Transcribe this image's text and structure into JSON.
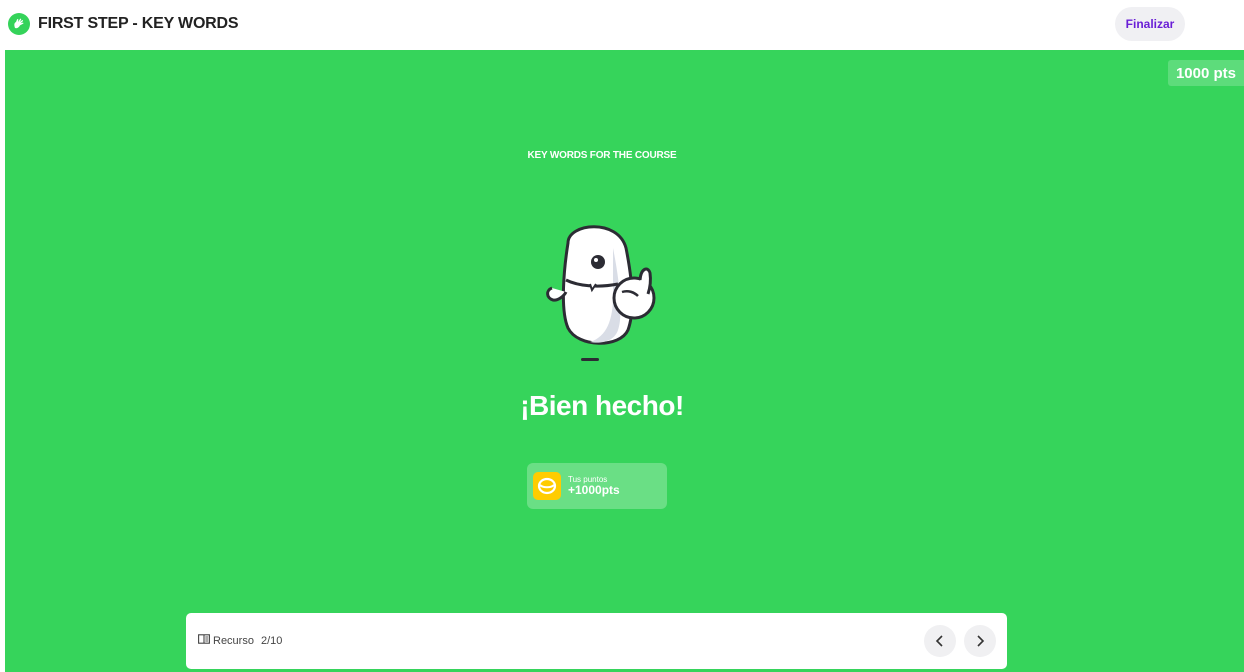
{
  "header": {
    "title": "FIRST STEP - KEY WORDS",
    "finish_label": "Finalizar"
  },
  "stage": {
    "points_chip": "1000 pts",
    "resource_title": "KEY WORDS FOR THE COURSE",
    "headline": "¡Bien hecho!",
    "earned": {
      "label": "Tus puntos",
      "value": "+1000pts"
    }
  },
  "resource_bar": {
    "label": "Recurso",
    "position": "2/10"
  },
  "icons": {
    "brand": "hand-logo-icon",
    "coin": "coin-icon",
    "book": "book-icon",
    "prev": "chevron-left-icon",
    "next": "chevron-right-icon"
  },
  "colors": {
    "stage_background": "#36d45b",
    "accent_purple": "#6a1fd6",
    "coin_yellow": "#ffcc00"
  }
}
